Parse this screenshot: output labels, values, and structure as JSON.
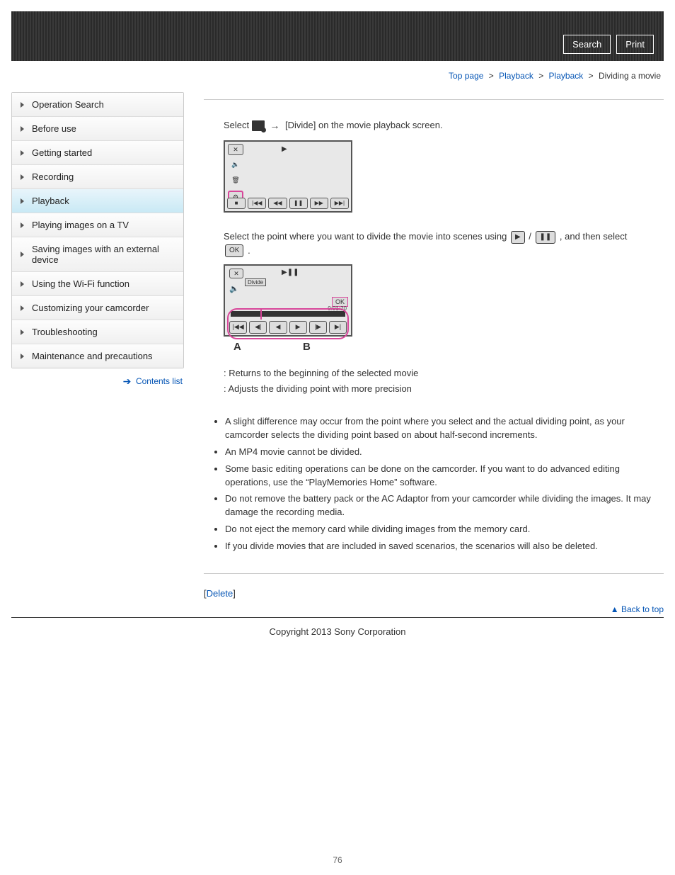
{
  "header": {
    "search": "Search",
    "print": "Print"
  },
  "breadcrumb": {
    "top": "Top page",
    "cat1": "Playback",
    "cat2": "Playback",
    "current": "Dividing a movie"
  },
  "sidebar": {
    "items": [
      "Operation Search",
      "Before use",
      "Getting started",
      "Recording",
      "Playback",
      "Playing images on a TV",
      "Saving images with an external device",
      "Using the Wi-Fi function",
      "Customizing your camcorder",
      "Troubleshooting",
      "Maintenance and precautions"
    ],
    "active_index": 4,
    "contents_link": "Contents list"
  },
  "content": {
    "step1_pre": "Select ",
    "step1_post": " [Divide] on the movie playback screen.",
    "step2_pre": "Select the point where you want to divide the movie into scenes using ",
    "step2_slash": " / ",
    "step2_post": ", and then select ",
    "step2_end": ".",
    "ok_label": "OK",
    "screen2": {
      "divide": "Divide",
      "ok": "OK",
      "time": "0:01:20"
    },
    "label_a": "A",
    "label_b": "B",
    "desc_a": ": Returns to the beginning of the selected movie",
    "desc_b": ": Adjusts the dividing point with more precision",
    "notes": [
      "A slight difference may occur from the point where you select and the actual dividing point, as your camcorder selects the dividing point based on about half-second increments.",
      "An MP4 movie cannot be divided.",
      "Some basic editing operations can be done on the camcorder. If you want to do advanced editing operations, use the “PlayMemories Home” software.",
      "Do not remove the battery pack or the AC Adaptor from your camcorder while dividing the images. It may damage the recording media.",
      "Do not eject the memory card while dividing images from the memory card.",
      "If you divide movies that are included in saved scenarios, the scenarios will also be deleted."
    ],
    "related_link": "Delete",
    "back_to_top": "Back to top"
  },
  "footer": {
    "copyright": "Copyright 2013 Sony Corporation",
    "page_num": "76"
  }
}
